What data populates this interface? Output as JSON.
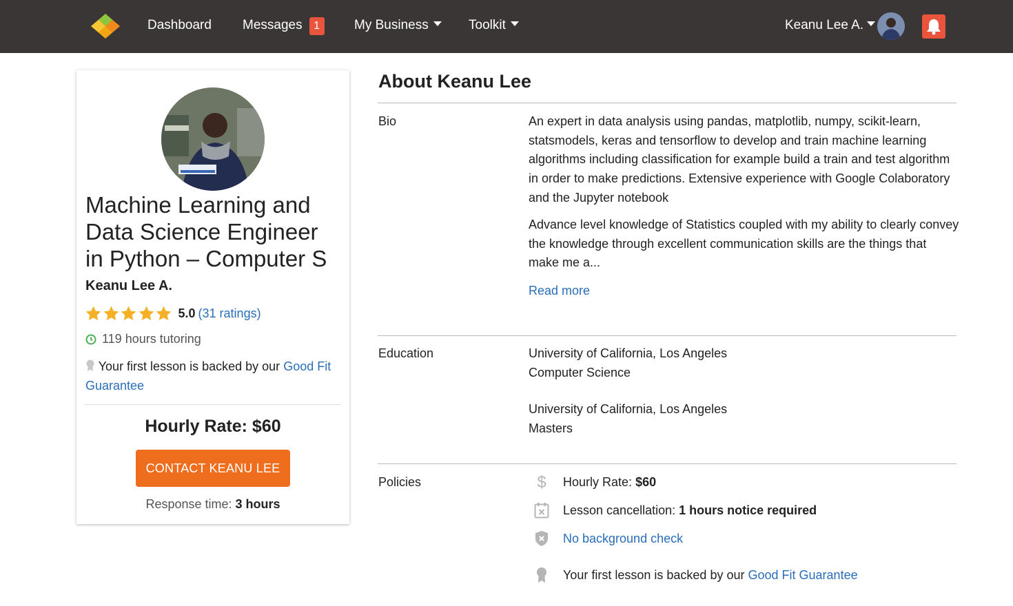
{
  "nav": {
    "dashboard": "Dashboard",
    "messages": "Messages",
    "messages_badge": "1",
    "my_business": "My Business",
    "toolkit": "Toolkit",
    "user_name": "Keanu Lee A.",
    "colors": {
      "bar": "#3a3635",
      "accent": "#e8553c"
    }
  },
  "profile": {
    "headline": "Machine Learning and Data Science Engineer in Python – Computer S",
    "name": "Keanu Lee A.",
    "rating_value": "5.0",
    "rating_stars": 5,
    "ratings_count_text": "(31 ratings)",
    "hours_text": "119 hours tutoring",
    "guarantee_prefix": "Your first lesson is backed by our",
    "guarantee_link": "Good Fit Guarantee",
    "hourly_rate": "Hourly Rate: $60",
    "contact_button": "CONTACT KEANU LEE",
    "response_label": "Response time:",
    "response_value": "3 hours",
    "colors": {
      "star": "#f5b026",
      "button": "#ee6e1e",
      "link": "#2a6ebb"
    }
  },
  "about": {
    "title": "About Keanu Lee",
    "bio_label": "Bio",
    "bio_paragraph_1": "An expert in data analysis using pandas, matplotlib, numpy, scikit-learn, statsmodels, keras and tensorflow to develop and train machine learning algorithms including classification for example build a train and test algorithm in order to make predictions. Extensive experience with Google Colaboratory and the Jupyter notebook",
    "bio_paragraph_2": "Advance level knowledge of Statistics coupled with my ability to clearly convey the knowledge through excellent communication skills are the things that make me a...",
    "read_more": "Read more",
    "education_label": "Education",
    "education": [
      {
        "school": "University of California, Los Angeles",
        "degree": "Computer Science"
      },
      {
        "school": "University of California, Los Angeles",
        "degree": "Masters"
      }
    ],
    "policies_label": "Policies",
    "policies": {
      "rate_label": "Hourly Rate:",
      "rate_value": "$60",
      "cancel_label": "Lesson cancellation:",
      "cancel_value": "1 hours notice required",
      "background_check": "No background check",
      "guarantee_prefix": "Your first lesson is backed by our",
      "guarantee_link": "Good Fit Guarantee"
    },
    "icons": [
      "dollar-icon",
      "calendar-cancel-icon",
      "shield-x-icon",
      "award-ribbon-icon"
    ]
  }
}
